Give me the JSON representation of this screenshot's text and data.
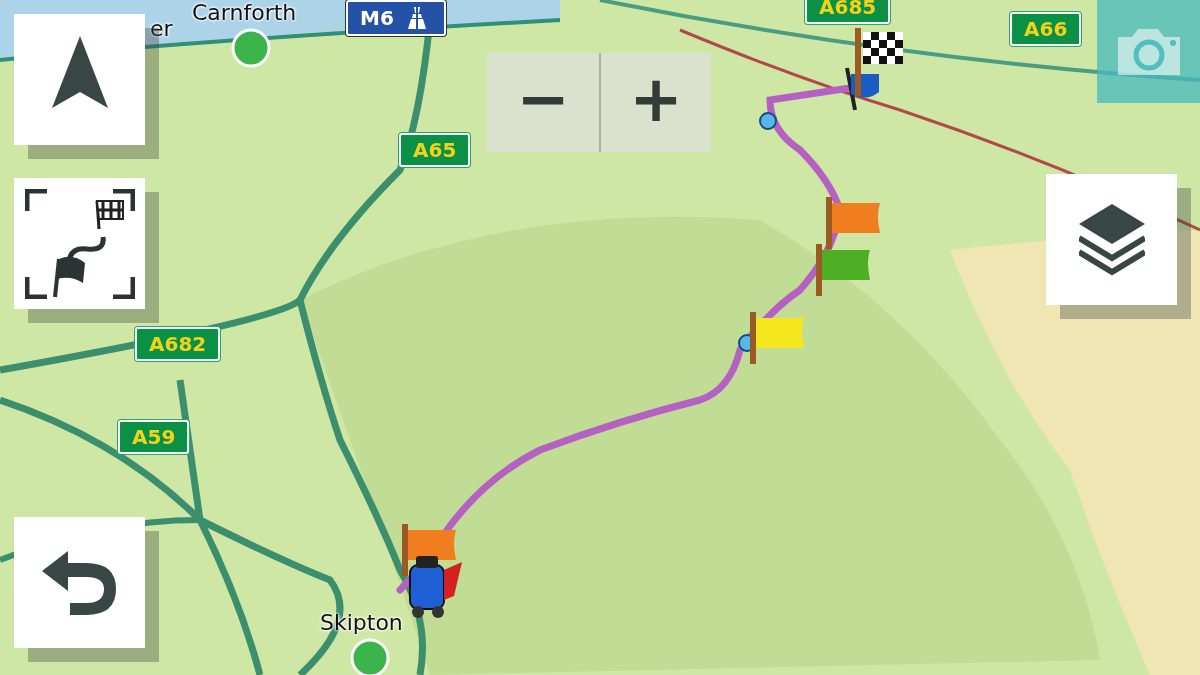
{
  "map": {
    "places": [
      {
        "name": "er"
      },
      {
        "name": "Carnforth"
      },
      {
        "name": "Skipton"
      }
    ],
    "road_signs": [
      {
        "label": "M6",
        "kind": "motorway"
      },
      {
        "label": "A685",
        "kind": "primary"
      },
      {
        "label": "A66",
        "kind": "primary"
      },
      {
        "label": "A65",
        "kind": "primary"
      },
      {
        "label": "A682",
        "kind": "primary"
      },
      {
        "label": "A59",
        "kind": "primary"
      }
    ],
    "route_flags": [
      {
        "kind": "checkered"
      },
      {
        "kind": "flag",
        "color": "#f07d1e"
      },
      {
        "kind": "flag",
        "color": "#4caf24"
      },
      {
        "kind": "flag",
        "color": "#f5e61e"
      },
      {
        "kind": "flag",
        "color": "#f07d1e"
      }
    ]
  },
  "zoom_controls": [
    {
      "label": "−"
    },
    {
      "label": "+"
    }
  ]
}
